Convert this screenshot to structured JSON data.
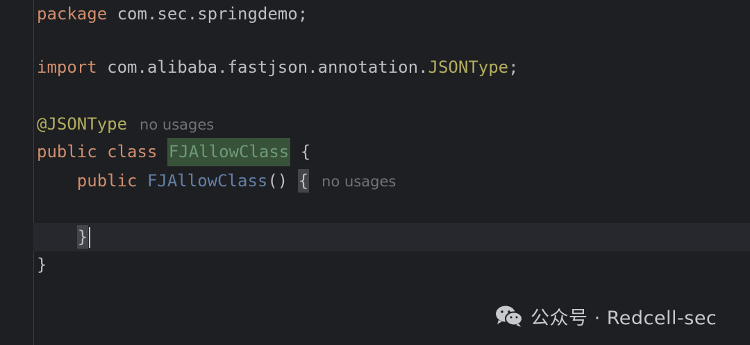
{
  "code": {
    "line1": {
      "keyword": "package",
      "text": " com.sec.springdemo;"
    },
    "line2": {
      "keyword": "import",
      "text_before": " com.alibaba.fastjson.annotation.",
      "annotation_type": "JSONType",
      "text_after": ";"
    },
    "line3": {
      "annotation": "@JSONType",
      "hint": "no usages"
    },
    "line4": {
      "kw1": "public",
      "kw2": " class ",
      "class_name": "FJAllowClass",
      "brace": " {"
    },
    "line5": {
      "indent": "    ",
      "keyword": "public",
      "space": " ",
      "ctor_name": "FJAllowClass",
      "parens": "() ",
      "brace": "{",
      "hint": "no usages"
    },
    "line6": {
      "indent": "    ",
      "brace": "}"
    },
    "line7": {
      "brace": "}"
    }
  },
  "watermark": {
    "icon": "wechat-icon",
    "text": "公众号 · Redcell-sec"
  }
}
